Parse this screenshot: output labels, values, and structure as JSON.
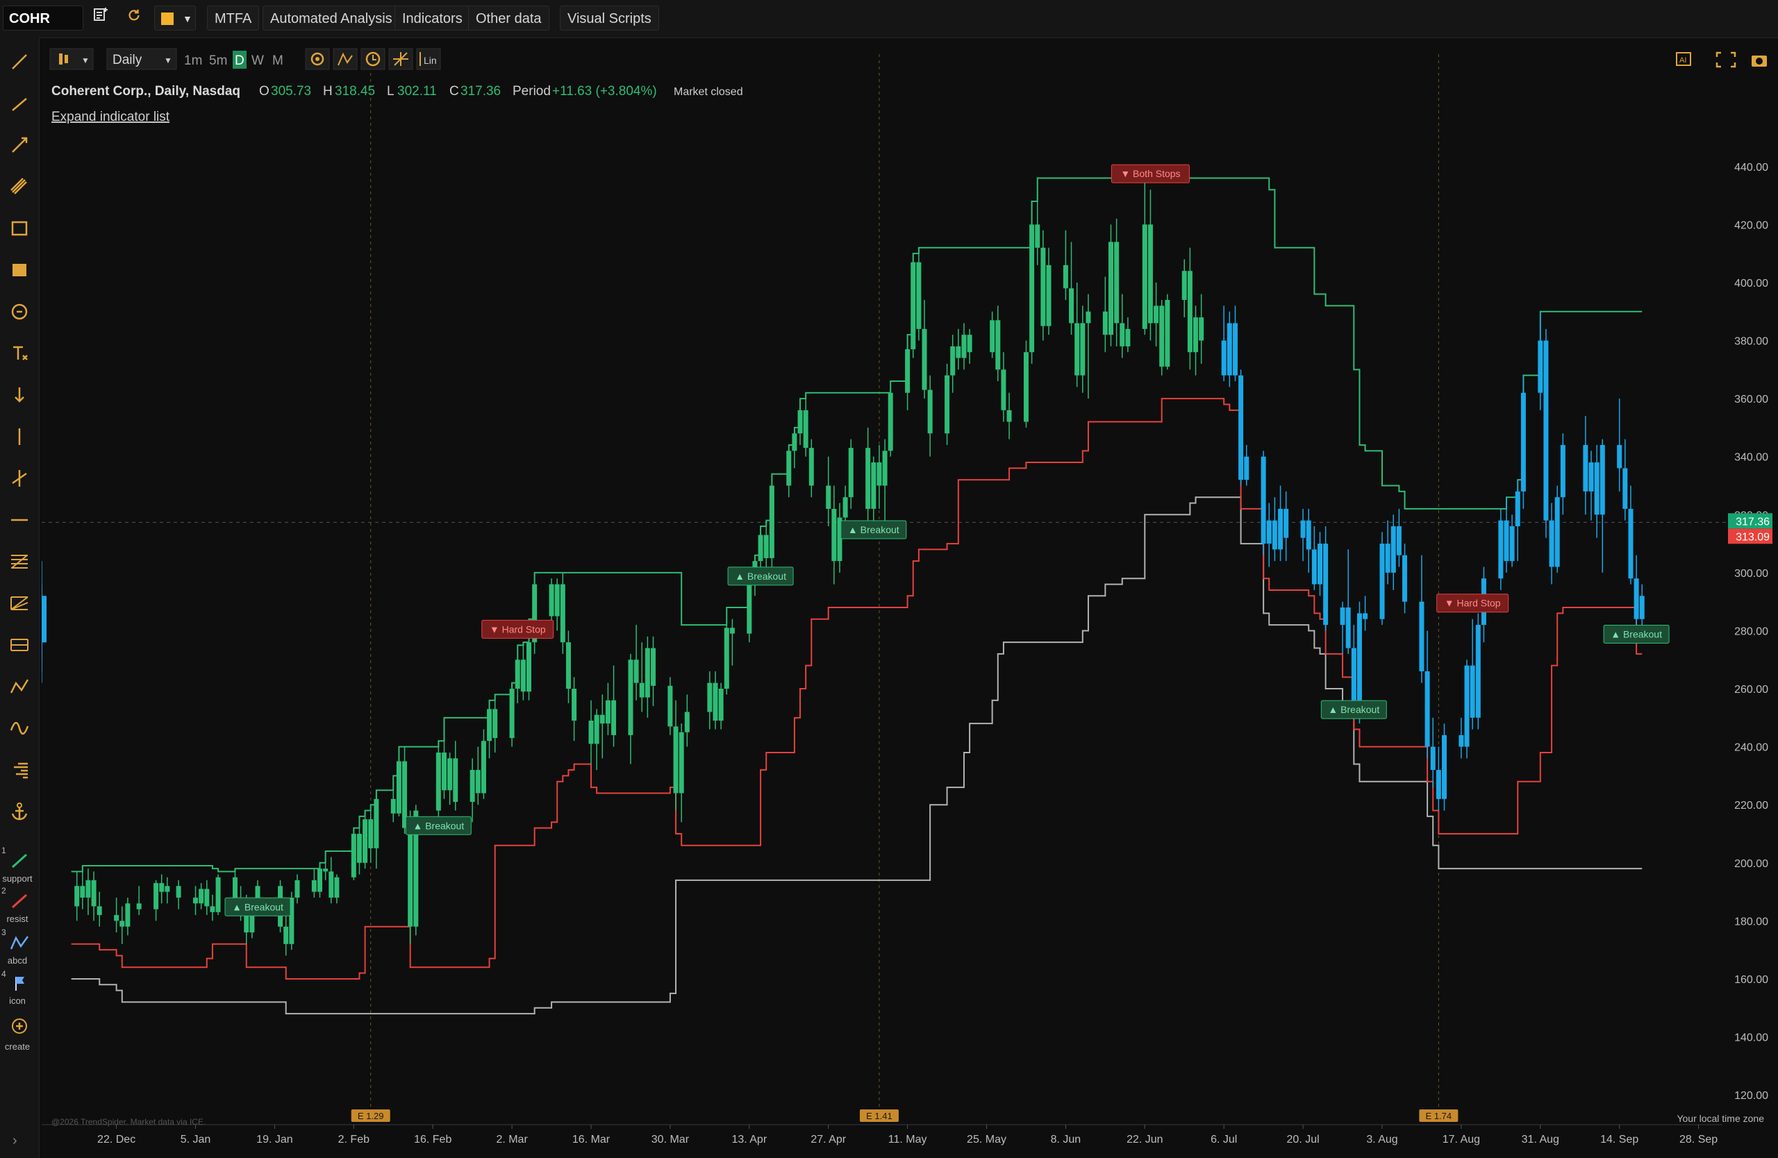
{
  "toolbar": {
    "symbol": "COHR",
    "buttons": [
      "MTFA",
      "Automated Analysis",
      "Indicators",
      "Other data",
      "Visual Scripts"
    ]
  },
  "chart_toolbar": {
    "interval": "Daily",
    "timeframes": [
      "1m",
      "5m",
      "D",
      "W",
      "M"
    ],
    "active_timeframe": "D",
    "lin_label": "Lin",
    "ai_label": "AI"
  },
  "header": {
    "name": "Coherent Corp., Daily, Nasdaq",
    "o_label": "O",
    "o": "305.73",
    "h_label": "H",
    "h": "318.45",
    "l_label": "L",
    "l": "302.11",
    "c_label": "C",
    "c": "317.36",
    "period_label": "Period",
    "period": "+11.63 (+3.804%)",
    "status": "Market closed",
    "expand": "Expand indicator list"
  },
  "sidebar_labels": [
    "support",
    "resist",
    "abcd",
    "icon",
    "create"
  ],
  "sidebar_numbers": [
    "1",
    "2",
    "3",
    "4"
  ],
  "footer": {
    "copyright": "@2026 TrendSpider. Market data via ICE.",
    "timezone": "Your local time zone"
  },
  "colors": {
    "up": "#2ebd75",
    "down": "#1ba9e8",
    "green_line": "#2ebd75",
    "red_line": "#e8413c",
    "gray_line": "#b3b3b3",
    "accent": "#e0a53a",
    "last_price": "#17a673",
    "stop_price": "#e8413c"
  },
  "chart_data": {
    "type": "candlestick",
    "x": [
      "2025-12-15",
      "2025-12-16",
      "2025-12-17",
      "2025-12-18",
      "2025-12-19",
      "2025-12-22",
      "2025-12-23",
      "2025-12-24",
      "2025-12-26",
      "2025-12-29",
      "2025-12-30",
      "2025-12-31",
      "2026-01-02",
      "2026-01-05",
      "2026-01-06",
      "2026-01-07",
      "2026-01-08",
      "2026-01-09",
      "2026-01-12",
      "2026-01-13",
      "2026-01-14",
      "2026-01-15",
      "2026-01-16",
      "2026-01-20",
      "2026-01-21",
      "2026-01-22",
      "2026-01-23",
      "2026-01-26",
      "2026-01-27",
      "2026-01-28",
      "2026-01-29",
      "2026-01-30",
      "2026-02-02",
      "2026-02-03",
      "2026-02-04",
      "2026-02-05",
      "2026-02-06",
      "2026-02-09",
      "2026-02-10",
      "2026-02-11",
      "2026-02-12",
      "2026-02-13",
      "2026-02-17",
      "2026-02-18",
      "2026-02-19",
      "2026-02-20",
      "2026-02-23",
      "2026-02-24",
      "2026-02-25",
      "2026-02-26",
      "2026-02-27",
      "2026-03-02",
      "2026-03-03",
      "2026-03-04",
      "2026-03-05",
      "2026-03-06",
      "2026-03-09",
      "2026-03-10",
      "2026-03-11",
      "2026-03-12",
      "2026-03-13",
      "2026-03-16",
      "2026-03-17",
      "2026-03-18",
      "2026-03-19",
      "2026-03-20",
      "2026-03-23",
      "2026-03-24",
      "2026-03-25",
      "2026-03-26",
      "2026-03-27",
      "2026-03-30",
      "2026-03-31",
      "2026-04-01",
      "2026-04-02",
      "2026-04-06",
      "2026-04-07",
      "2026-04-08",
      "2026-04-09",
      "2026-04-10",
      "2026-04-13",
      "2026-04-14",
      "2026-04-15",
      "2026-04-16",
      "2026-04-17",
      "2026-04-20",
      "2026-04-21",
      "2026-04-22",
      "2026-04-23",
      "2026-04-24",
      "2026-04-27",
      "2026-04-28",
      "2026-04-29",
      "2026-04-30",
      "2026-05-01",
      "2026-05-04",
      "2026-05-05",
      "2026-05-06",
      "2026-05-07",
      "2026-05-08",
      "2026-05-11",
      "2026-05-12",
      "2026-05-13",
      "2026-05-14",
      "2026-05-15",
      "2026-05-18",
      "2026-05-19",
      "2026-05-20",
      "2026-05-21",
      "2026-05-22",
      "2026-05-26",
      "2026-05-27",
      "2026-05-28",
      "2026-05-29",
      "2026-06-01",
      "2026-06-02",
      "2026-06-03",
      "2026-06-04",
      "2026-06-05",
      "2026-06-08",
      "2026-06-09",
      "2026-06-10",
      "2026-06-11",
      "2026-06-12",
      "2026-06-15",
      "2026-06-16",
      "2026-06-17",
      "2026-06-18",
      "2026-06-19",
      "2026-06-22",
      "2026-06-23",
      "2026-06-24",
      "2026-06-25",
      "2026-06-26",
      "2026-06-29",
      "2026-06-30",
      "2026-07-01",
      "2026-07-02",
      "2026-07-06",
      "2026-07-07",
      "2026-07-08",
      "2026-07-09",
      "2026-07-10",
      "2026-07-13",
      "2026-07-14",
      "2026-07-15",
      "2026-07-16",
      "2026-07-17",
      "2026-07-20",
      "2026-07-21",
      "2026-07-22",
      "2026-07-23",
      "2026-07-24",
      "2026-07-27",
      "2026-07-28",
      "2026-07-29",
      "2026-07-30",
      "2026-07-31",
      "2026-08-03",
      "2026-08-04",
      "2026-08-05",
      "2026-08-06",
      "2026-08-07",
      "2026-08-10",
      "2026-08-11",
      "2026-08-12",
      "2026-08-13",
      "2026-08-14",
      "2026-08-17",
      "2026-08-18",
      "2026-08-19",
      "2026-08-20",
      "2026-08-21",
      "2026-08-24",
      "2026-08-25",
      "2026-08-26",
      "2026-08-27",
      "2026-08-28",
      "2026-08-31",
      "2026-09-01",
      "2026-09-02",
      "2026-09-03",
      "2026-09-04",
      "2026-09-08",
      "2026-09-09",
      "2026-09-10",
      "2026-09-11",
      "2026-09-14",
      "2026-09-15",
      "2026-09-16",
      "2026-09-17",
      "2026-09-18"
    ],
    "ohlc": [
      [
        185,
        197,
        180,
        192
      ],
      [
        192,
        199,
        184,
        188
      ],
      [
        188,
        198,
        182,
        194
      ],
      [
        194,
        197,
        180,
        185
      ],
      [
        185,
        190,
        178,
        182
      ],
      [
        182,
        188,
        176,
        180
      ],
      [
        180,
        185,
        172,
        178
      ],
      [
        178,
        188,
        175,
        186
      ],
      [
        186,
        192,
        182,
        184
      ],
      [
        184,
        194,
        180,
        193
      ],
      [
        193,
        196,
        186,
        190
      ],
      [
        190,
        195,
        186,
        192
      ],
      [
        192,
        194,
        184,
        188
      ],
      [
        188,
        192,
        182,
        186
      ],
      [
        186,
        193,
        184,
        191
      ],
      [
        191,
        194,
        182,
        185
      ],
      [
        185,
        189,
        180,
        183
      ],
      [
        183,
        196,
        182,
        195
      ],
      [
        195,
        198,
        186,
        188
      ],
      [
        188,
        192,
        180,
        183
      ],
      [
        183,
        189,
        172,
        176
      ],
      [
        176,
        188,
        174,
        187
      ],
      [
        187,
        194,
        186,
        192
      ],
      [
        192,
        194,
        176,
        178
      ],
      [
        178,
        186,
        168,
        172
      ],
      [
        172,
        190,
        170,
        188
      ],
      [
        188,
        196,
        186,
        194
      ],
      [
        194,
        198,
        188,
        190
      ],
      [
        190,
        200,
        188,
        198
      ],
      [
        198,
        204,
        194,
        197
      ],
      [
        197,
        202,
        186,
        188
      ],
      [
        188,
        196,
        186,
        195
      ],
      [
        195,
        212,
        194,
        210
      ],
      [
        210,
        216,
        196,
        200
      ],
      [
        200,
        218,
        198,
        215
      ],
      [
        215,
        220,
        200,
        205
      ],
      [
        205,
        225,
        198,
        222
      ],
      [
        222,
        230,
        214,
        217
      ],
      [
        217,
        240,
        216,
        235
      ],
      [
        235,
        240,
        210,
        212
      ],
      [
        212,
        218,
        172,
        178
      ],
      [
        178,
        220,
        175,
        218
      ],
      [
        218,
        242,
        214,
        238
      ],
      [
        238,
        250,
        222,
        225
      ],
      [
        225,
        238,
        220,
        236
      ],
      [
        236,
        242,
        218,
        221
      ],
      [
        221,
        236,
        214,
        232
      ],
      [
        232,
        240,
        220,
        224
      ],
      [
        224,
        246,
        222,
        242
      ],
      [
        242,
        256,
        236,
        253
      ],
      [
        253,
        258,
        238,
        243
      ],
      [
        243,
        262,
        240,
        260
      ],
      [
        260,
        275,
        255,
        270
      ],
      [
        270,
        276,
        256,
        259
      ],
      [
        259,
        284,
        256,
        276
      ],
      [
        276,
        300,
        272,
        296
      ],
      [
        296,
        298,
        278,
        285
      ],
      [
        285,
        298,
        280,
        296
      ],
      [
        296,
        300,
        272,
        276
      ],
      [
        276,
        280,
        255,
        260
      ],
      [
        260,
        264,
        242,
        249
      ],
      [
        249,
        256,
        234,
        241
      ],
      [
        241,
        253,
        232,
        251
      ],
      [
        251,
        258,
        236,
        248
      ],
      [
        248,
        262,
        244,
        256
      ],
      [
        256,
        268,
        240,
        244
      ],
      [
        244,
        272,
        234,
        270
      ],
      [
        270,
        282,
        256,
        262
      ],
      [
        262,
        276,
        252,
        257
      ],
      [
        257,
        278,
        250,
        274
      ],
      [
        274,
        278,
        254,
        261
      ],
      [
        261,
        264,
        244,
        247
      ],
      [
        247,
        256,
        218,
        224
      ],
      [
        224,
        248,
        214,
        245
      ],
      [
        245,
        258,
        240,
        252
      ],
      [
        252,
        266,
        246,
        262
      ],
      [
        262,
        266,
        246,
        249
      ],
      [
        249,
        262,
        246,
        260
      ],
      [
        260,
        288,
        258,
        281
      ],
      [
        281,
        284,
        268,
        279
      ],
      [
        279,
        300,
        276,
        298
      ],
      [
        298,
        306,
        292,
        304
      ],
      [
        304,
        316,
        300,
        313
      ],
      [
        313,
        318,
        296,
        305
      ],
      [
        305,
        334,
        302,
        330
      ],
      [
        330,
        344,
        326,
        342
      ],
      [
        342,
        350,
        336,
        348
      ],
      [
        348,
        360,
        344,
        356
      ],
      [
        356,
        362,
        340,
        343
      ],
      [
        343,
        346,
        326,
        330
      ],
      [
        330,
        340,
        316,
        322
      ],
      [
        322,
        330,
        296,
        304
      ],
      [
        304,
        324,
        300,
        319
      ],
      [
        319,
        330,
        312,
        326
      ],
      [
        326,
        346,
        322,
        343
      ],
      [
        343,
        350,
        318,
        322
      ],
      [
        322,
        340,
        316,
        338
      ],
      [
        338,
        344,
        322,
        330
      ],
      [
        330,
        346,
        318,
        342
      ],
      [
        342,
        366,
        340,
        362
      ],
      [
        362,
        382,
        356,
        377
      ],
      [
        377,
        410,
        374,
        407
      ],
      [
        407,
        412,
        380,
        384
      ],
      [
        384,
        394,
        360,
        363
      ],
      [
        363,
        368,
        340,
        348
      ],
      [
        348,
        372,
        344,
        368
      ],
      [
        368,
        382,
        362,
        378
      ],
      [
        378,
        384,
        370,
        374
      ],
      [
        374,
        386,
        370,
        382
      ],
      [
        382,
        384,
        372,
        376
      ],
      [
        376,
        390,
        374,
        387
      ],
      [
        387,
        392,
        366,
        370
      ],
      [
        370,
        376,
        352,
        356
      ],
      [
        356,
        362,
        346,
        352
      ],
      [
        352,
        380,
        350,
        376
      ],
      [
        376,
        428,
        372,
        420
      ],
      [
        420,
        436,
        406,
        412
      ],
      [
        412,
        418,
        380,
        385
      ],
      [
        385,
        412,
        382,
        406
      ],
      [
        406,
        418,
        394,
        398
      ],
      [
        398,
        414,
        382,
        386
      ],
      [
        386,
        400,
        364,
        368
      ],
      [
        368,
        392,
        362,
        386
      ],
      [
        386,
        396,
        360,
        390
      ],
      [
        390,
        402,
        376,
        382
      ],
      [
        382,
        420,
        378,
        414
      ],
      [
        414,
        422,
        378,
        386
      ],
      [
        386,
        396,
        374,
        378
      ],
      [
        378,
        388,
        376,
        384
      ],
      [
        384,
        436,
        382,
        420
      ],
      [
        420,
        432,
        380,
        386
      ],
      [
        386,
        400,
        378,
        392
      ],
      [
        392,
        394,
        368,
        371
      ],
      [
        371,
        396,
        370,
        394
      ],
      [
        394,
        408,
        388,
        404
      ],
      [
        404,
        412,
        370,
        376
      ],
      [
        376,
        392,
        368,
        388
      ],
      [
        388,
        396,
        372,
        380
      ],
      [
        380,
        392,
        366,
        368
      ],
      [
        368,
        390,
        364,
        386
      ],
      [
        386,
        392,
        366,
        368
      ],
      [
        368,
        370,
        330,
        332
      ],
      [
        332,
        344,
        330,
        340
      ],
      [
        340,
        342,
        306,
        310
      ],
      [
        310,
        324,
        302,
        318
      ],
      [
        318,
        326,
        304,
        308
      ],
      [
        308,
        330,
        304,
        322
      ],
      [
        322,
        328,
        304,
        312
      ],
      [
        312,
        322,
        304,
        318
      ],
      [
        318,
        322,
        300,
        308
      ],
      [
        308,
        316,
        294,
        296
      ],
      [
        296,
        314,
        292,
        310
      ],
      [
        310,
        316,
        280,
        282
      ],
      [
        282,
        290,
        272,
        288
      ],
      [
        288,
        308,
        272,
        274
      ],
      [
        274,
        282,
        254,
        256
      ],
      [
        256,
        290,
        248,
        286
      ],
      [
        286,
        292,
        280,
        284
      ],
      [
        284,
        314,
        282,
        310
      ],
      [
        310,
        318,
        296,
        300
      ],
      [
        300,
        320,
        294,
        316
      ],
      [
        316,
        322,
        302,
        306
      ],
      [
        306,
        310,
        286,
        290
      ],
      [
        290,
        306,
        262,
        266
      ],
      [
        266,
        280,
        236,
        240
      ],
      [
        240,
        250,
        226,
        232
      ],
      [
        232,
        240,
        218,
        222
      ],
      [
        222,
        248,
        218,
        244
      ],
      [
        244,
        250,
        236,
        240
      ],
      [
        240,
        270,
        236,
        268
      ],
      [
        268,
        284,
        246,
        250
      ],
      [
        250,
        286,
        246,
        282
      ],
      [
        282,
        302,
        276,
        298
      ],
      [
        298,
        322,
        294,
        318
      ],
      [
        318,
        326,
        300,
        304
      ],
      [
        304,
        320,
        302,
        316
      ],
      [
        316,
        332,
        304,
        328
      ],
      [
        328,
        368,
        322,
        362
      ],
      [
        362,
        390,
        356,
        380
      ],
      [
        380,
        384,
        312,
        318
      ],
      [
        318,
        324,
        296,
        302
      ],
      [
        302,
        330,
        300,
        326
      ],
      [
        326,
        348,
        320,
        344
      ],
      [
        344,
        354,
        320,
        328
      ],
      [
        328,
        342,
        318,
        338
      ],
      [
        338,
        344,
        312,
        320
      ],
      [
        320,
        346,
        300,
        344
      ],
      [
        344,
        360,
        328,
        336
      ],
      [
        336,
        346,
        318,
        322
      ],
      [
        322,
        330,
        296,
        298
      ],
      [
        298,
        306,
        280,
        284
      ],
      [
        284,
        296,
        280,
        292
      ],
      [
        292,
        304,
        272,
        286
      ],
      [
        286,
        290,
        266,
        282
      ],
      [
        282,
        288,
        262,
        278
      ],
      [
        278,
        296,
        274,
        290
      ],
      [
        290,
        294,
        272,
        276
      ],
      [
        276,
        290,
        270,
        286
      ]
    ],
    "green_line": [],
    "red_line": [],
    "gray_line": [],
    "y_ticks": [
      "120.00",
      "140.00",
      "160.00",
      "180.00",
      "200.00",
      "220.00",
      "240.00",
      "260.00",
      "280.00",
      "300.00",
      "320.00",
      "340.00",
      "360.00",
      "380.00",
      "400.00",
      "420.00",
      "440.00"
    ],
    "x_labels": [
      "22. Dec",
      "5. Jan",
      "19. Jan",
      "2. Feb",
      "16. Feb",
      "2. Mar",
      "16. Mar",
      "30. Mar",
      "13. Apr",
      "27. Apr",
      "11. May",
      "25. May",
      "8. Jun",
      "22. Jun",
      "6. Jul",
      "20. Jul",
      "3. Aug",
      "17. Aug",
      "31. Aug",
      "14. Sep",
      "28. Sep"
    ],
    "earnings": [
      "E 1.29",
      "E 1.41",
      "E 1.74"
    ],
    "last_price": "317.36",
    "stop_price": "313.09",
    "signals": [
      "Breakout",
      "Breakout",
      "Hard Stop",
      "Breakout",
      "Breakout",
      "Both Stops",
      "Breakout",
      "Hard Stop",
      "Breakout"
    ],
    "ylim": [
      115,
      450
    ]
  }
}
